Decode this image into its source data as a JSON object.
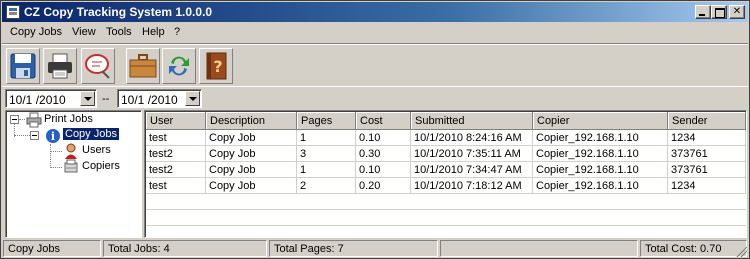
{
  "window": {
    "title": "CZ Copy Tracking System 1.0.0.0"
  },
  "menu": [
    "Copy Jobs",
    "View",
    "Tools",
    "Help",
    "?"
  ],
  "toolbar": {
    "buttons": [
      "save-icon",
      "printer-icon",
      "search-icon",
      "toolbox-icon",
      "refresh-icon",
      "help-book-icon"
    ]
  },
  "date_filter": {
    "from": "10/1 /2010",
    "separator": "--",
    "to": "10/1 /2010"
  },
  "tree": {
    "root": "Print Jobs",
    "child": "Copy Jobs",
    "leaves": [
      "Users",
      "Copiers"
    ]
  },
  "table": {
    "columns": [
      "User",
      "Description",
      "Pages",
      "Cost",
      "Submitted",
      "Copier",
      "Sender"
    ],
    "rows": [
      [
        "test",
        "Copy Job",
        "1",
        "0.10",
        "10/1/2010 8:24:16 AM",
        "Copier_192.168.1.10",
        "1234"
      ],
      [
        "test2",
        "Copy Job",
        "3",
        "0.30",
        "10/1/2010 7:35:11 AM",
        "Copier_192.168.1.10",
        "373761"
      ],
      [
        "test2",
        "Copy Job",
        "1",
        "0.10",
        "10/1/2010 7:34:47 AM",
        "Copier_192.168.1.10",
        "373761"
      ],
      [
        "test",
        "Copy Job",
        "2",
        "0.20",
        "10/1/2010 7:18:12 AM",
        "Copier_192.168.1.10",
        "1234"
      ]
    ]
  },
  "status": {
    "view": "Copy Jobs",
    "total_jobs": "Total Jobs: 4",
    "total_pages": "Total Pages: 7",
    "empty": "",
    "total_cost": "Total Cost: 0.70"
  },
  "colors": {
    "title_start": "#0a246a",
    "title_end": "#a6caf0",
    "chrome": "#d4d0c8",
    "selection": "#0a246a"
  }
}
